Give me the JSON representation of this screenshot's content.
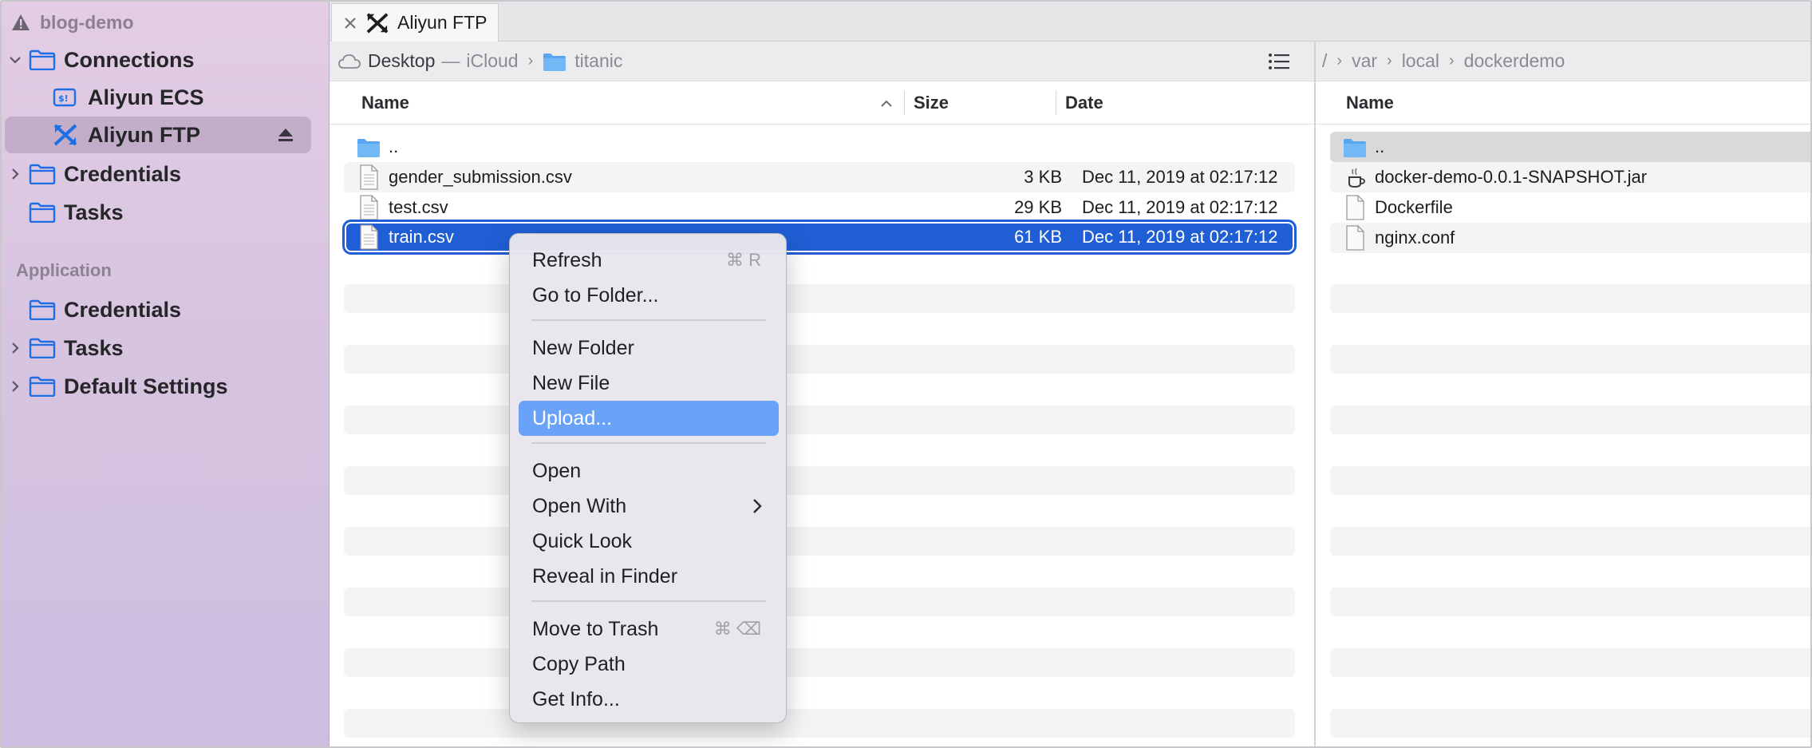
{
  "sidebar": {
    "project": "blog-demo",
    "connections_label": "Connections",
    "connections": [
      {
        "label": "Aliyun ECS"
      },
      {
        "label": "Aliyun FTP"
      }
    ],
    "credentials_label": "Credentials",
    "tasks_label": "Tasks",
    "application_section": "Application",
    "app_items": [
      {
        "label": "Credentials"
      },
      {
        "label": "Tasks"
      },
      {
        "label": "Default Settings"
      }
    ]
  },
  "tab": {
    "label": "Aliyun FTP"
  },
  "left_pane": {
    "path": {
      "root": "Desktop",
      "sep": "—",
      "cloud": "iCloud",
      "folder": "titanic"
    },
    "columns": {
      "name": "Name",
      "size": "Size",
      "date": "Date"
    },
    "files": [
      {
        "name": "..",
        "size": "",
        "date": ""
      },
      {
        "name": "gender_submission.csv",
        "size": "3 KB",
        "date": "Dec 11, 2019 at 02:17:12"
      },
      {
        "name": "test.csv",
        "size": "29 KB",
        "date": "Dec 11, 2019 at 02:17:12"
      },
      {
        "name": "train.csv",
        "size": "61 KB",
        "date": "Dec 11, 2019 at 02:17:12"
      }
    ]
  },
  "right_pane": {
    "path": {
      "root": "/",
      "p1": "var",
      "p2": "local",
      "p3": "dockerdemo"
    },
    "columns": {
      "name": "Name"
    },
    "files": [
      {
        "name": ".."
      },
      {
        "name": "docker-demo-0.0.1-SNAPSHOT.jar"
      },
      {
        "name": "Dockerfile"
      },
      {
        "name": "nginx.conf"
      }
    ]
  },
  "context_menu": {
    "refresh": "Refresh",
    "refresh_shortcut": "⌘ R",
    "go_to_folder": "Go to Folder...",
    "new_folder": "New Folder",
    "new_file": "New File",
    "upload": "Upload...",
    "open": "Open",
    "open_with": "Open With",
    "quick_look": "Quick Look",
    "reveal": "Reveal in Finder",
    "trash": "Move to Trash",
    "trash_shortcut": "⌘ ⌫",
    "copy_path": "Copy Path",
    "get_info": "Get Info..."
  },
  "colors": {
    "accent": "#1f5ed4",
    "menu_highlight": "#6aa2f8",
    "folder_blue": "#1e6fe6",
    "warning": "#6b6470"
  }
}
